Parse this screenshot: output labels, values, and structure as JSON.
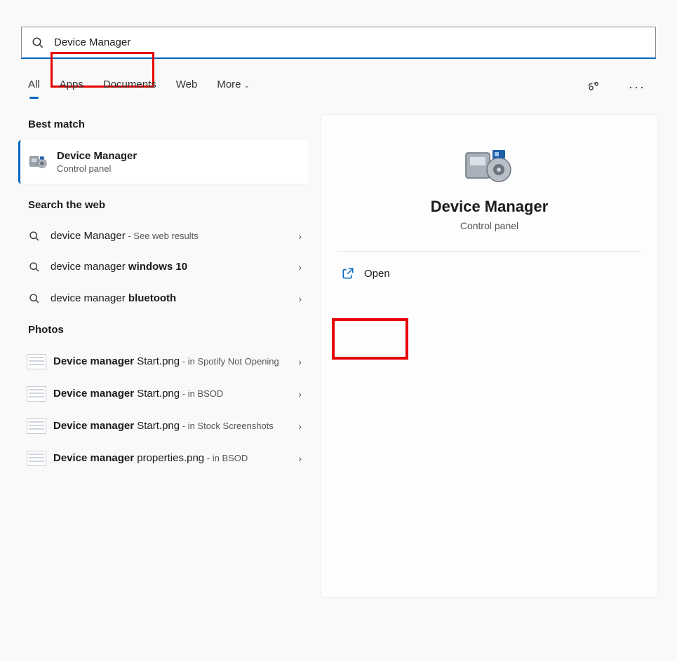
{
  "search": {
    "value": "Device Manager"
  },
  "tabs": {
    "all": "All",
    "apps": "Apps",
    "documents": "Documents",
    "web": "Web",
    "more": "More"
  },
  "sections": {
    "best_match": "Best match",
    "search_web": "Search the web",
    "photos": "Photos"
  },
  "best_match": {
    "title": "Device Manager",
    "subtitle": "Control panel"
  },
  "web_results": [
    {
      "prefix": "device Manager",
      "bold": "",
      "suffix": " - See web results"
    },
    {
      "prefix": "device manager ",
      "bold": "windows 10",
      "suffix": ""
    },
    {
      "prefix": "device manager ",
      "bold": "bluetooth",
      "suffix": ""
    }
  ],
  "photos": [
    {
      "bold": "Device manager",
      "rest": " Start.png",
      "loc": " - in Spotify Not Opening"
    },
    {
      "bold": "Device manager",
      "rest": " Start.png",
      "loc": " - in BSOD"
    },
    {
      "bold": "Device manager",
      "rest": " Start.png",
      "loc": " - in Stock Screenshots"
    },
    {
      "bold": "Device manager",
      "rest": " properties.png",
      "loc": " - in BSOD"
    }
  ],
  "preview": {
    "title": "Device Manager",
    "subtitle": "Control panel",
    "open": "Open"
  }
}
